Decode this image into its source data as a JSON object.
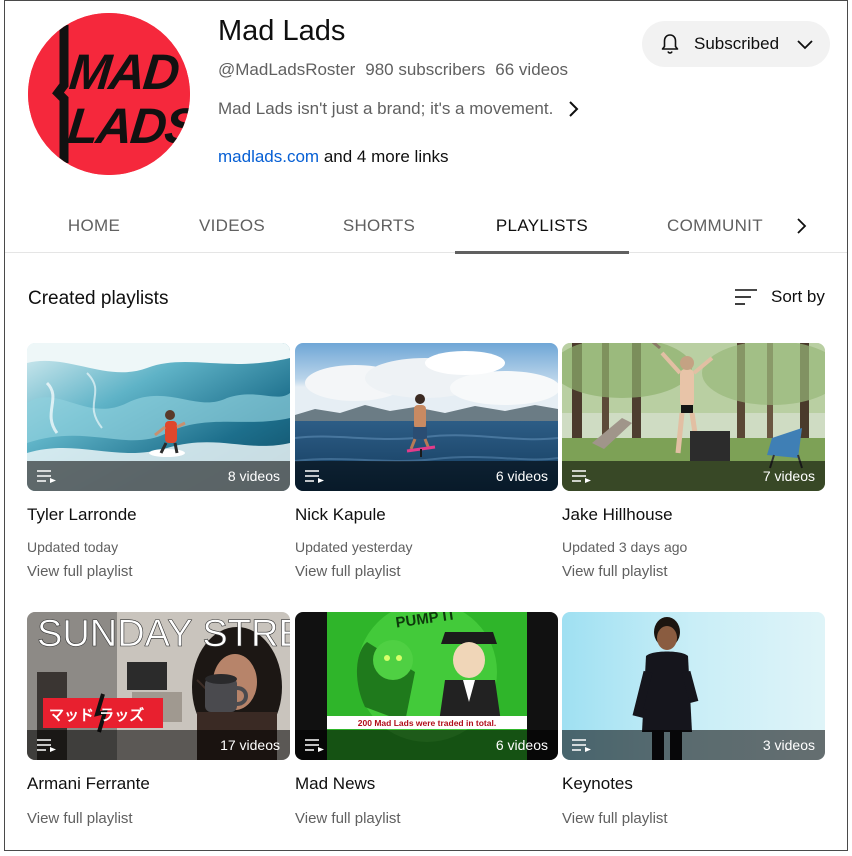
{
  "channel": {
    "title": "Mad Lads",
    "handle": "@MadLadsRoster",
    "subscribers": "980 subscribers",
    "videos": "66 videos",
    "description": "Mad Lads isn't just a brand; it's a movement.",
    "link_primary": "madlads.com",
    "link_more": " and 4 more links",
    "avatar_text_line1": "MAD",
    "avatar_text_line2": "LADS",
    "avatar_color": "#f5283c"
  },
  "subscribe": {
    "label": "Subscribed"
  },
  "tabs": [
    {
      "label": "HOME"
    },
    {
      "label": "VIDEOS"
    },
    {
      "label": "SHORTS"
    },
    {
      "label": "PLAYLISTS",
      "active": true
    },
    {
      "label": "COMMUNITY"
    }
  ],
  "section": {
    "title": "Created playlists",
    "sort_label": "Sort by"
  },
  "playlists": [
    {
      "title": "Tyler Larronde",
      "count": "8 videos",
      "updated": "Updated today",
      "link": "View full playlist",
      "thumb": "surfer-wave"
    },
    {
      "title": "Nick Kapule",
      "count": "6 videos",
      "updated": "Updated yesterday",
      "link": "View full playlist",
      "thumb": "foil-surfer"
    },
    {
      "title": "Jake Hillhouse",
      "count": "7 videos",
      "updated": "Updated 3 days ago",
      "link": "View full playlist",
      "thumb": "forest-man"
    },
    {
      "title": "Armani Ferrante",
      "count": "17 videos",
      "link": "View full playlist",
      "thumb": "sunday-stream",
      "thumb_text": "SUNDAY STREAM",
      "thumb_badge": "マッド ラッズ"
    },
    {
      "title": "Mad News",
      "count": "6 videos",
      "link": "View full playlist",
      "thumb": "mad-news-cartoon",
      "thumb_text": "200 Mad Lads were traded in total.",
      "thumb_top_text": "PUMP IT"
    },
    {
      "title": "Keynotes",
      "count": "3 videos",
      "link": "View full playlist",
      "thumb": "keynote-speaker"
    }
  ],
  "icons": {
    "bell": "bell-icon",
    "chevron_down": "chevron-down-icon",
    "chevron_right": "chevron-right-icon",
    "sort": "sort-icon",
    "playlist": "playlist-icon"
  }
}
